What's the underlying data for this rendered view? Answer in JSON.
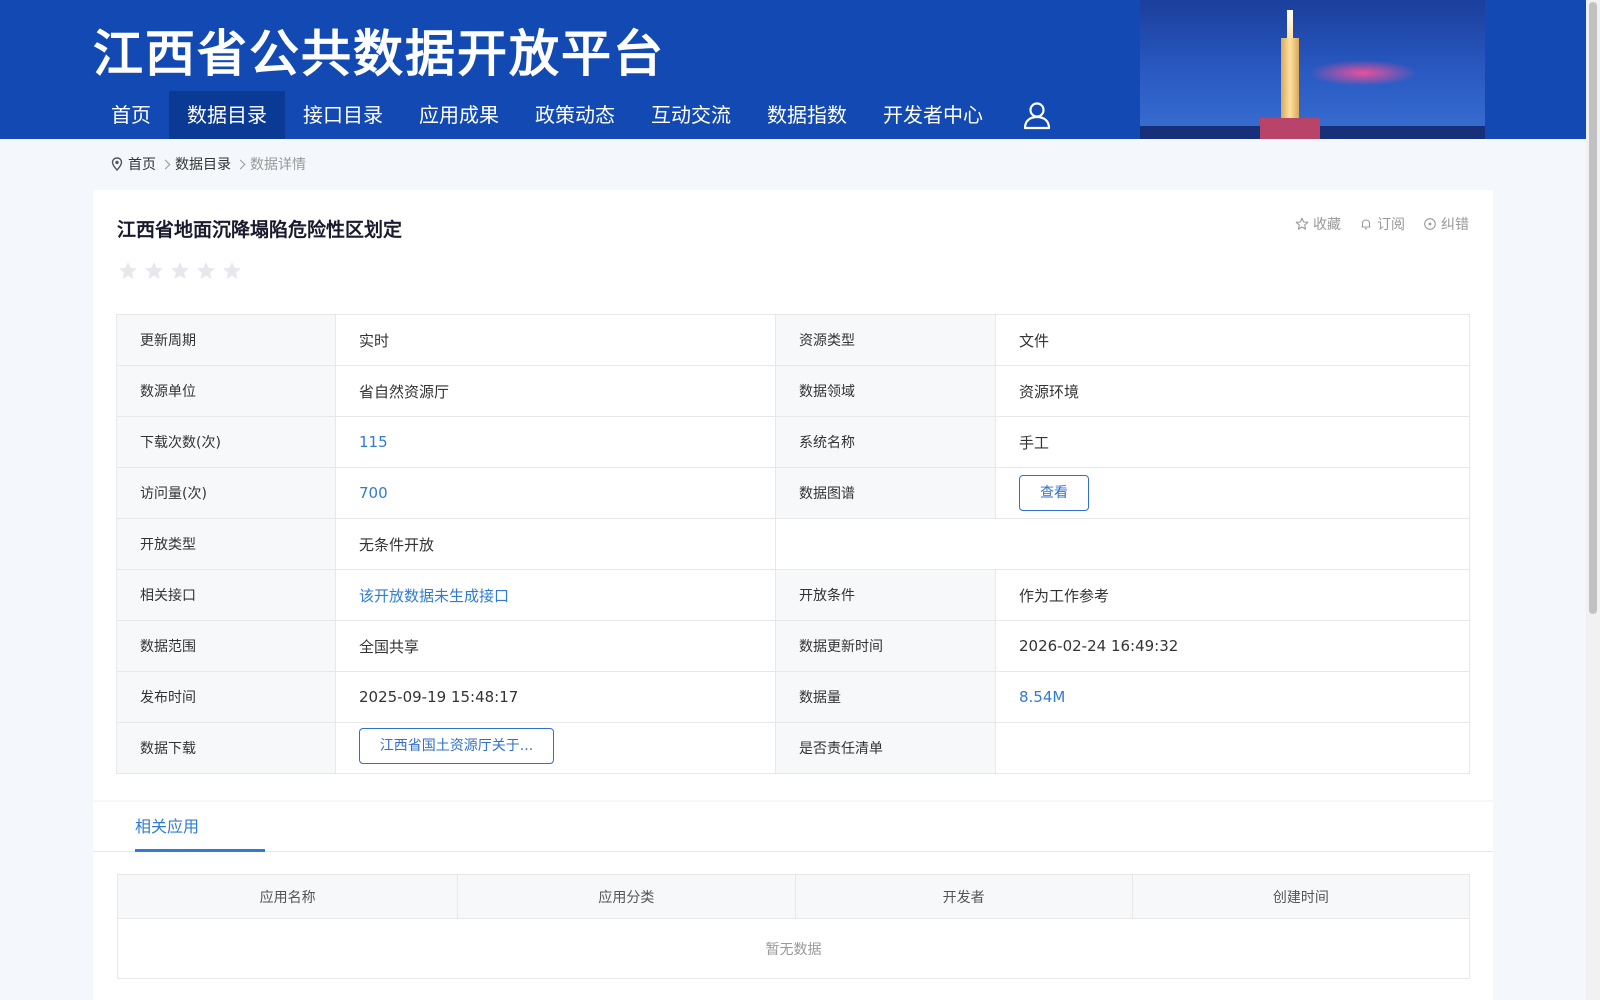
{
  "header": {
    "title": "江西省公共数据开放平台",
    "nav": [
      {
        "label": "首页"
      },
      {
        "label": "数据目录",
        "active": true
      },
      {
        "label": "接口目录"
      },
      {
        "label": "应用成果"
      },
      {
        "label": "政策动态"
      },
      {
        "label": "互动交流"
      },
      {
        "label": "数据指数"
      },
      {
        "label": "开发者中心"
      }
    ],
    "user_icon": "user-icon"
  },
  "breadcrumb": {
    "icon": "location-pin-icon",
    "items": [
      "首页",
      "数据目录",
      "数据详情"
    ]
  },
  "detail": {
    "title": "江西省地面沉降塌陷危险性区划定",
    "rating": {
      "filled": 0,
      "max": 5
    },
    "actions": {
      "favorite": "收藏",
      "subscribe": "订阅",
      "report": "纠错"
    },
    "fields": {
      "update_cycle": {
        "label": "更新周期",
        "value": "实时"
      },
      "resource_type": {
        "label": "资源类型",
        "value": "文件"
      },
      "source_unit": {
        "label": "数源单位",
        "value": "省自然资源厅"
      },
      "data_domain": {
        "label": "数据领域",
        "value": "资源环境"
      },
      "download_count": {
        "label": "下载次数(次)",
        "value": "115"
      },
      "system_name": {
        "label": "系统名称",
        "value": "手工"
      },
      "visit_count": {
        "label": "访问量(次)",
        "value": "700"
      },
      "data_graph": {
        "label": "数据图谱",
        "button": "查看"
      },
      "open_type": {
        "label": "开放类型",
        "value": "无条件开放"
      },
      "related_api": {
        "label": "相关接口",
        "value": "该开放数据未生成接口"
      },
      "open_condition": {
        "label": "开放条件",
        "value": "作为工作参考"
      },
      "data_scope": {
        "label": "数据范围",
        "value": "全国共享"
      },
      "data_update_time": {
        "label": "数据更新时间",
        "value": "2026-02-24 16:49:32"
      },
      "publish_time": {
        "label": "发布时间",
        "value": "2025-09-19 15:48:17"
      },
      "data_volume": {
        "label": "数据量",
        "value": "8.54M"
      },
      "data_download": {
        "label": "数据下载",
        "button": "江西省国土资源厅关于..."
      },
      "responsibility_list": {
        "label": "是否责任清单",
        "value": ""
      }
    }
  },
  "related": {
    "tab": "相关应用",
    "columns": [
      "应用名称",
      "应用分类",
      "开发者",
      "创建时间"
    ],
    "empty_text": "暂无数据"
  },
  "colors": {
    "header_bg": "#1249b2",
    "nav_active": "#0b3a94",
    "link": "#2f7bd8"
  }
}
